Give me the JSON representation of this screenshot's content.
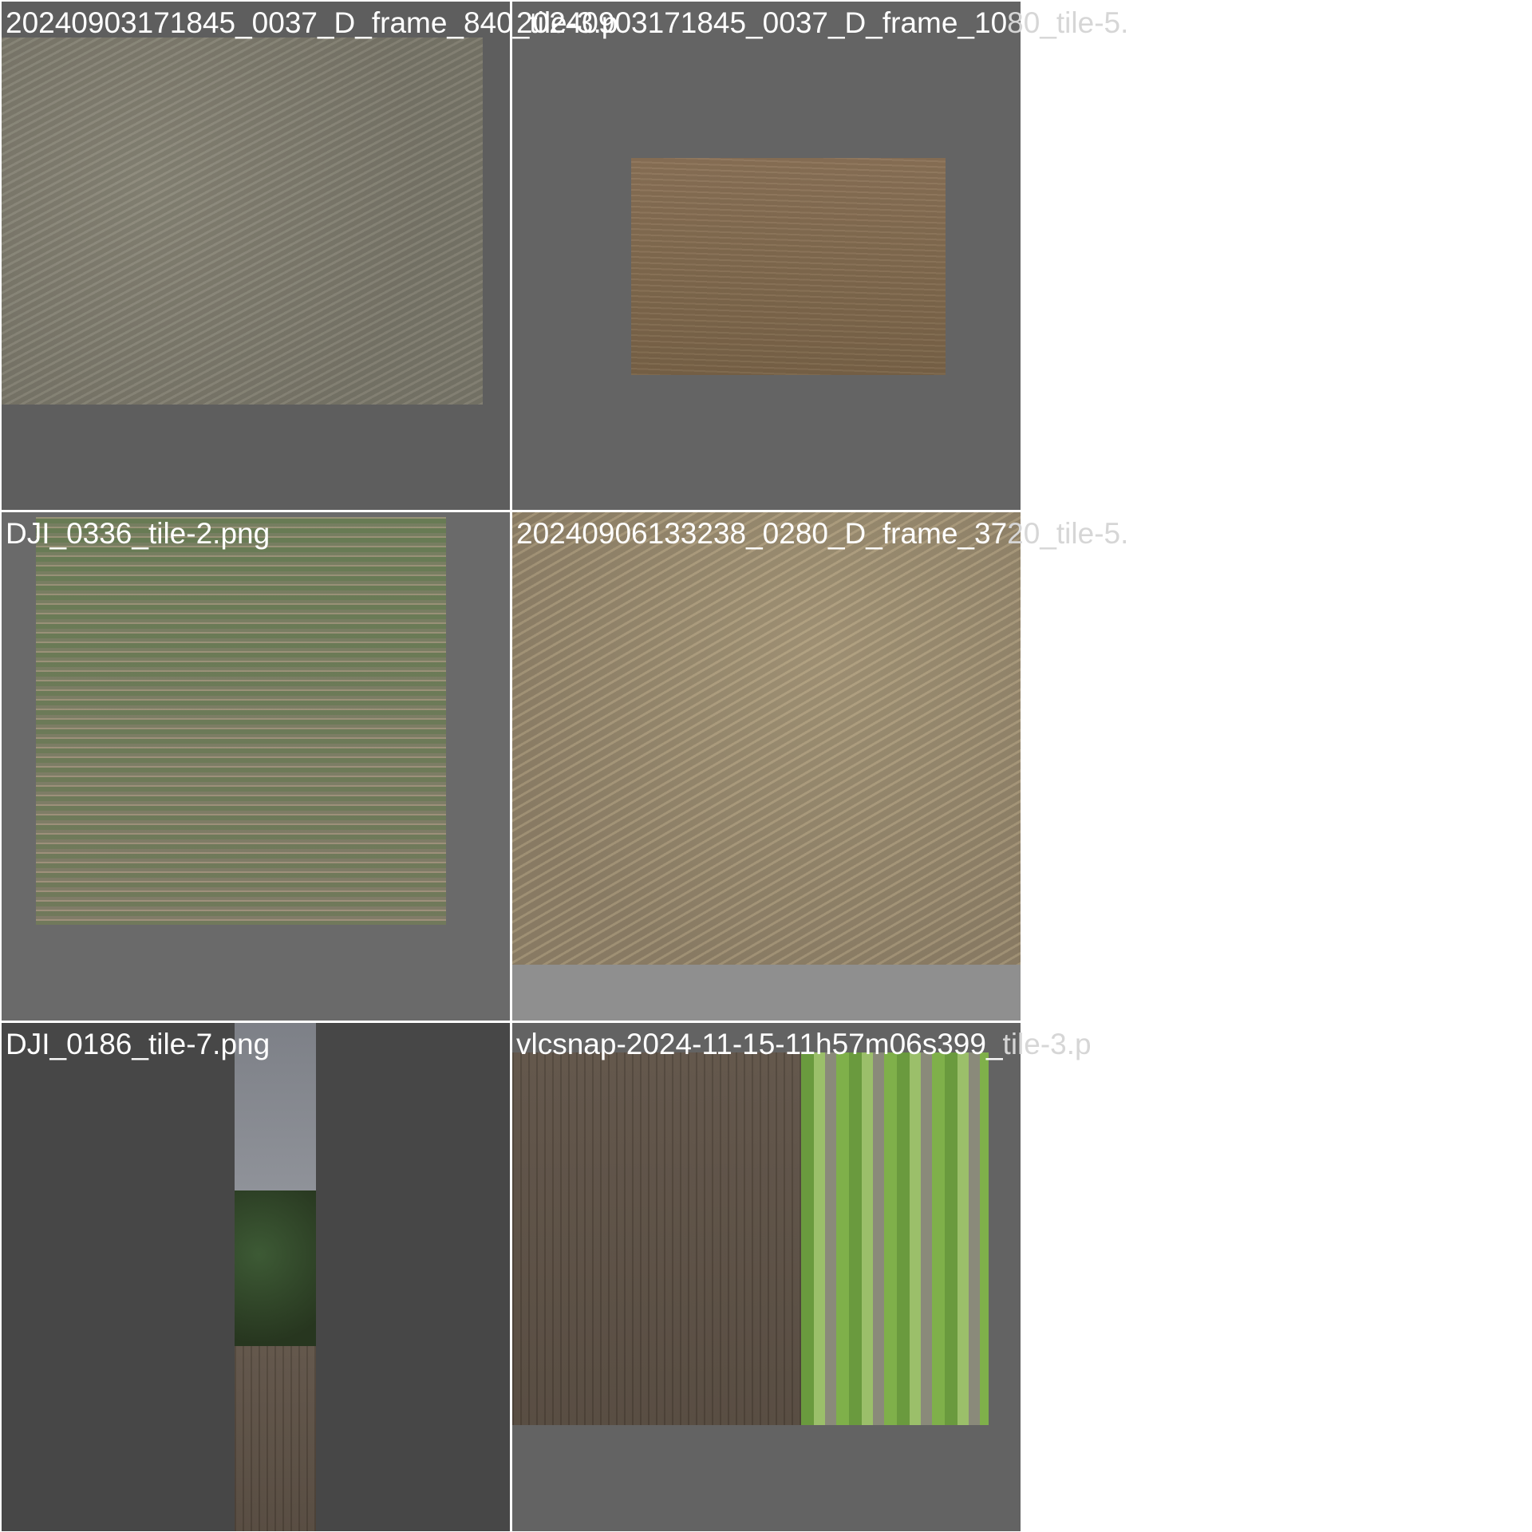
{
  "tiles": [
    {
      "caption": "20240903171845_0037_D_frame_840_tile-3.p",
      "caption_head": "20240903171845_0037_D_frame_840_tile-3.p",
      "caption_tail": "",
      "bg": "#5e5e5e"
    },
    {
      "caption": "20240903171845_0037_D_frame_1080_tile-5.",
      "caption_head": "20240903171845_0037_D_frame_10",
      "caption_tail": "80_tile-5.",
      "bg": "#646464"
    },
    {
      "caption": "DJI_0336_tile-2.png",
      "caption_head": "DJI_0336_tile-2.png",
      "caption_tail": "",
      "bg": "#6a6a6a"
    },
    {
      "caption": "20240906133238_0280_D_frame_3720_tile-5.",
      "caption_head": "20240906133238_0280_D_frame_37",
      "caption_tail": "20_tile-5.",
      "bg": "#8f8f8f"
    },
    {
      "caption": "DJI_0186_tile-7.png",
      "caption_head": "DJI_0186_tile-7.png",
      "caption_tail": "",
      "bg": "#474747"
    },
    {
      "caption": "vlcsnap-2024-11-15-11h57m06s399_tile-3.p",
      "caption_head": "vlcsnap-2024-11-15-11h57m06s399_",
      "caption_tail": "tile-3.p",
      "bg": "#636363"
    }
  ]
}
